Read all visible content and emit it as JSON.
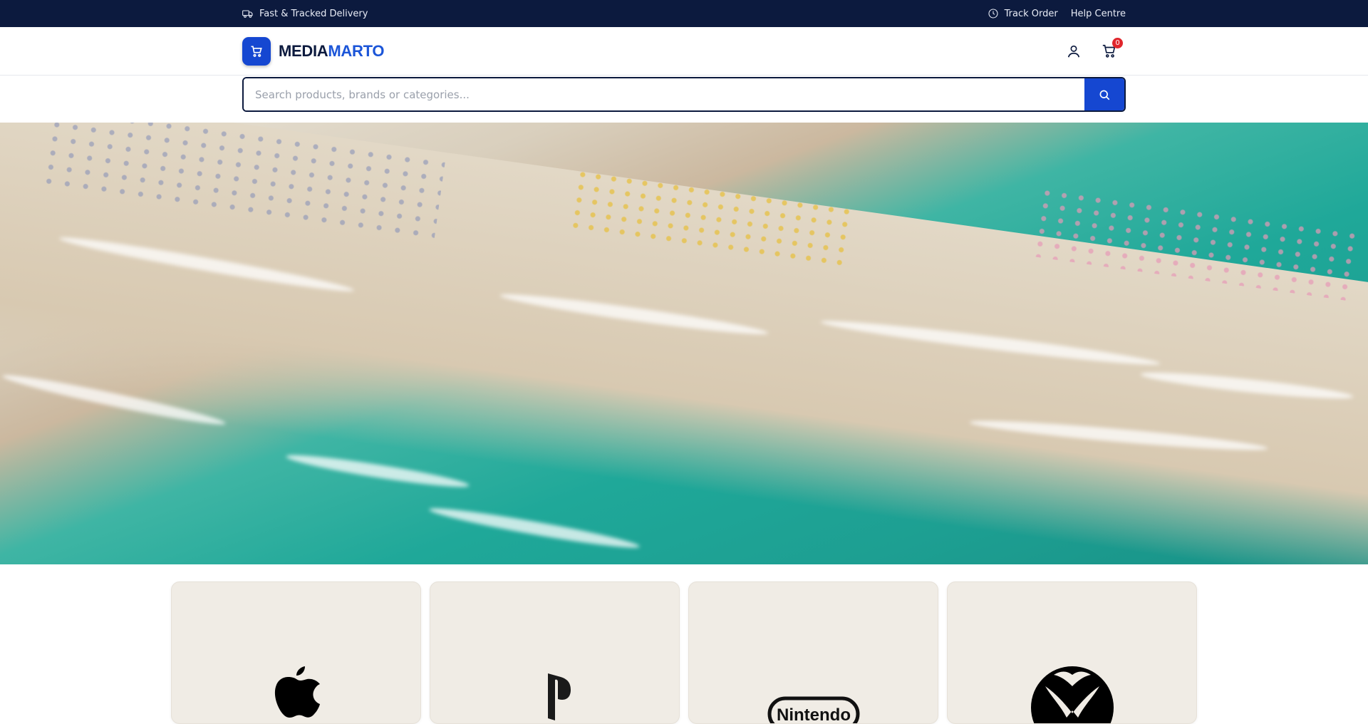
{
  "topbar": {
    "delivery": "Fast & Tracked Delivery",
    "track_order": "Track Order",
    "help_centre": "Help Centre"
  },
  "header": {
    "logo_part1": "MEDIA",
    "logo_part2": "MARTO",
    "cart_count": "0"
  },
  "search": {
    "placeholder": "Search products, brands or categories..."
  },
  "brands": [
    {
      "name": "Apple",
      "icon": "apple-icon"
    },
    {
      "name": "PlayStation",
      "icon": "playstation-icon"
    },
    {
      "name": "Nintendo",
      "icon": "nintendo-icon",
      "logo_text": "Nintendo"
    },
    {
      "name": "Xbox",
      "icon": "xbox-icon"
    }
  ],
  "colors": {
    "topbar_bg": "#0c1a3e",
    "accent": "#1547d1",
    "badge": "#e0262c",
    "card_bg": "#f0ece5"
  }
}
